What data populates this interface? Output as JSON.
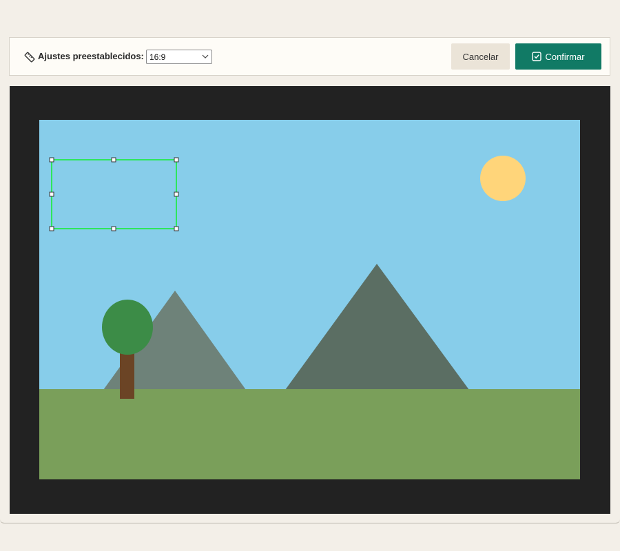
{
  "toolbar": {
    "preset_label": "Ajustes preestablecidos:",
    "preset_value": "16:9",
    "cancel_label": "Cancelar",
    "confirm_label": "Confirmar"
  },
  "icons": {
    "preset": "ruler-icon",
    "dropdown": "chevron-down-icon",
    "confirm": "checkbox-checked-icon"
  },
  "colors": {
    "confirm_button": "#117a65",
    "cancel_button": "#ebe4d8",
    "canvas_background": "#222222",
    "sky": "#87cdea",
    "grass": "#7a9f5a",
    "sun": "#ffd57a",
    "mountain_left": "#6e8279",
    "mountain_right": "#5b6e63",
    "tree_foliage": "#3c8c47",
    "tree_trunk": "#6b4425",
    "crop_border": "#2ee65c"
  }
}
